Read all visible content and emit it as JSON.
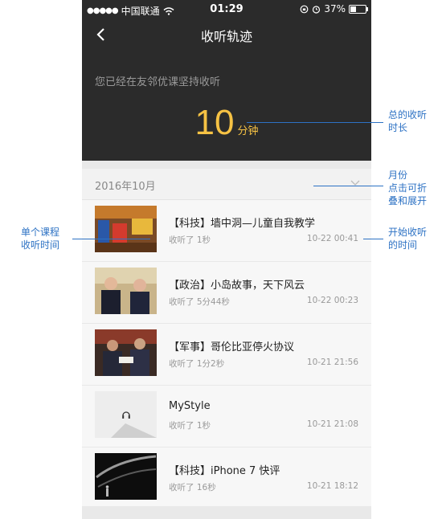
{
  "status_bar": {
    "carrier": "中国联通",
    "time": "01:29",
    "battery": "37%"
  },
  "header": {
    "title": "收听轨迹"
  },
  "summary": {
    "persist_text": "您已经在友邻优课坚持收听",
    "minutes_value": "10",
    "minutes_unit": "分钟"
  },
  "month": {
    "label": "2016年10月"
  },
  "items": [
    {
      "title": "【科技】墙中洞—儿童自我教学",
      "listened": "收听了 1秒",
      "date": "10-22 00:41"
    },
    {
      "title": "【政治】小岛故事，天下风云",
      "listened": "收听了 5分44秒",
      "date": "10-22 00:23"
    },
    {
      "title": "【军事】哥伦比亚停火协议",
      "listened": "收听了 1分2秒",
      "date": "10-21 21:56"
    },
    {
      "title": "MyStyle",
      "listened": "收听了 1秒",
      "date": "10-21 21:08"
    },
    {
      "title": "【科技】iPhone 7 快评",
      "listened": "收听了 16秒",
      "date": "10-21 18:12"
    }
  ],
  "annotations": {
    "total_time_l1": "总的收听",
    "total_time_l2": "时长",
    "month_l1": "月份",
    "month_l2": "点击可折",
    "month_l3": "叠和展开",
    "course_l1": "单个课程",
    "course_l2": "收听时间",
    "start_l1": "开始收听",
    "start_l2": "的时间"
  },
  "colors": {
    "dark_bg": "#2b2b2b",
    "accent": "#f6c244",
    "annotation": "#2d72c4"
  }
}
